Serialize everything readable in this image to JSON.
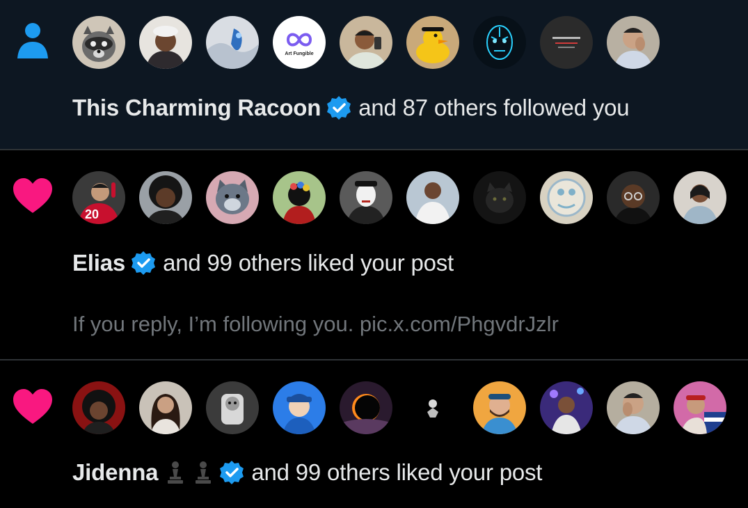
{
  "notifications": [
    {
      "kind": "follow",
      "type_icon": "person-icon",
      "type_color": "#1d9bf0",
      "avatar_count": 9,
      "name": "This Charming Racoon",
      "verified": true,
      "action": "and 87 others followed you",
      "avatar_labels": [
        "Art Fungible"
      ]
    },
    {
      "kind": "like",
      "type_icon": "heart-icon",
      "type_color": "#f91880",
      "avatar_count": 10,
      "name": "Elias",
      "verified": true,
      "action": "and 99 others liked your post",
      "snippet": "If you reply, I’m following you. pic.x.com/PhgvdrJzlr",
      "avatar_labels": [
        "20"
      ]
    },
    {
      "kind": "like",
      "type_icon": "heart-icon",
      "type_color": "#f91880",
      "avatar_count": 10,
      "name": "Jidenna",
      "name_emoji": [
        "pawn-icon",
        "pawn-icon"
      ],
      "verified": true,
      "action": "and 99 others liked your post"
    }
  ],
  "colors": {
    "follow_background": "#0d1722",
    "like_background": "#000000",
    "divider": "#2f3336",
    "verified_badge": "#1d9bf0",
    "secondary_text": "#71767b"
  }
}
